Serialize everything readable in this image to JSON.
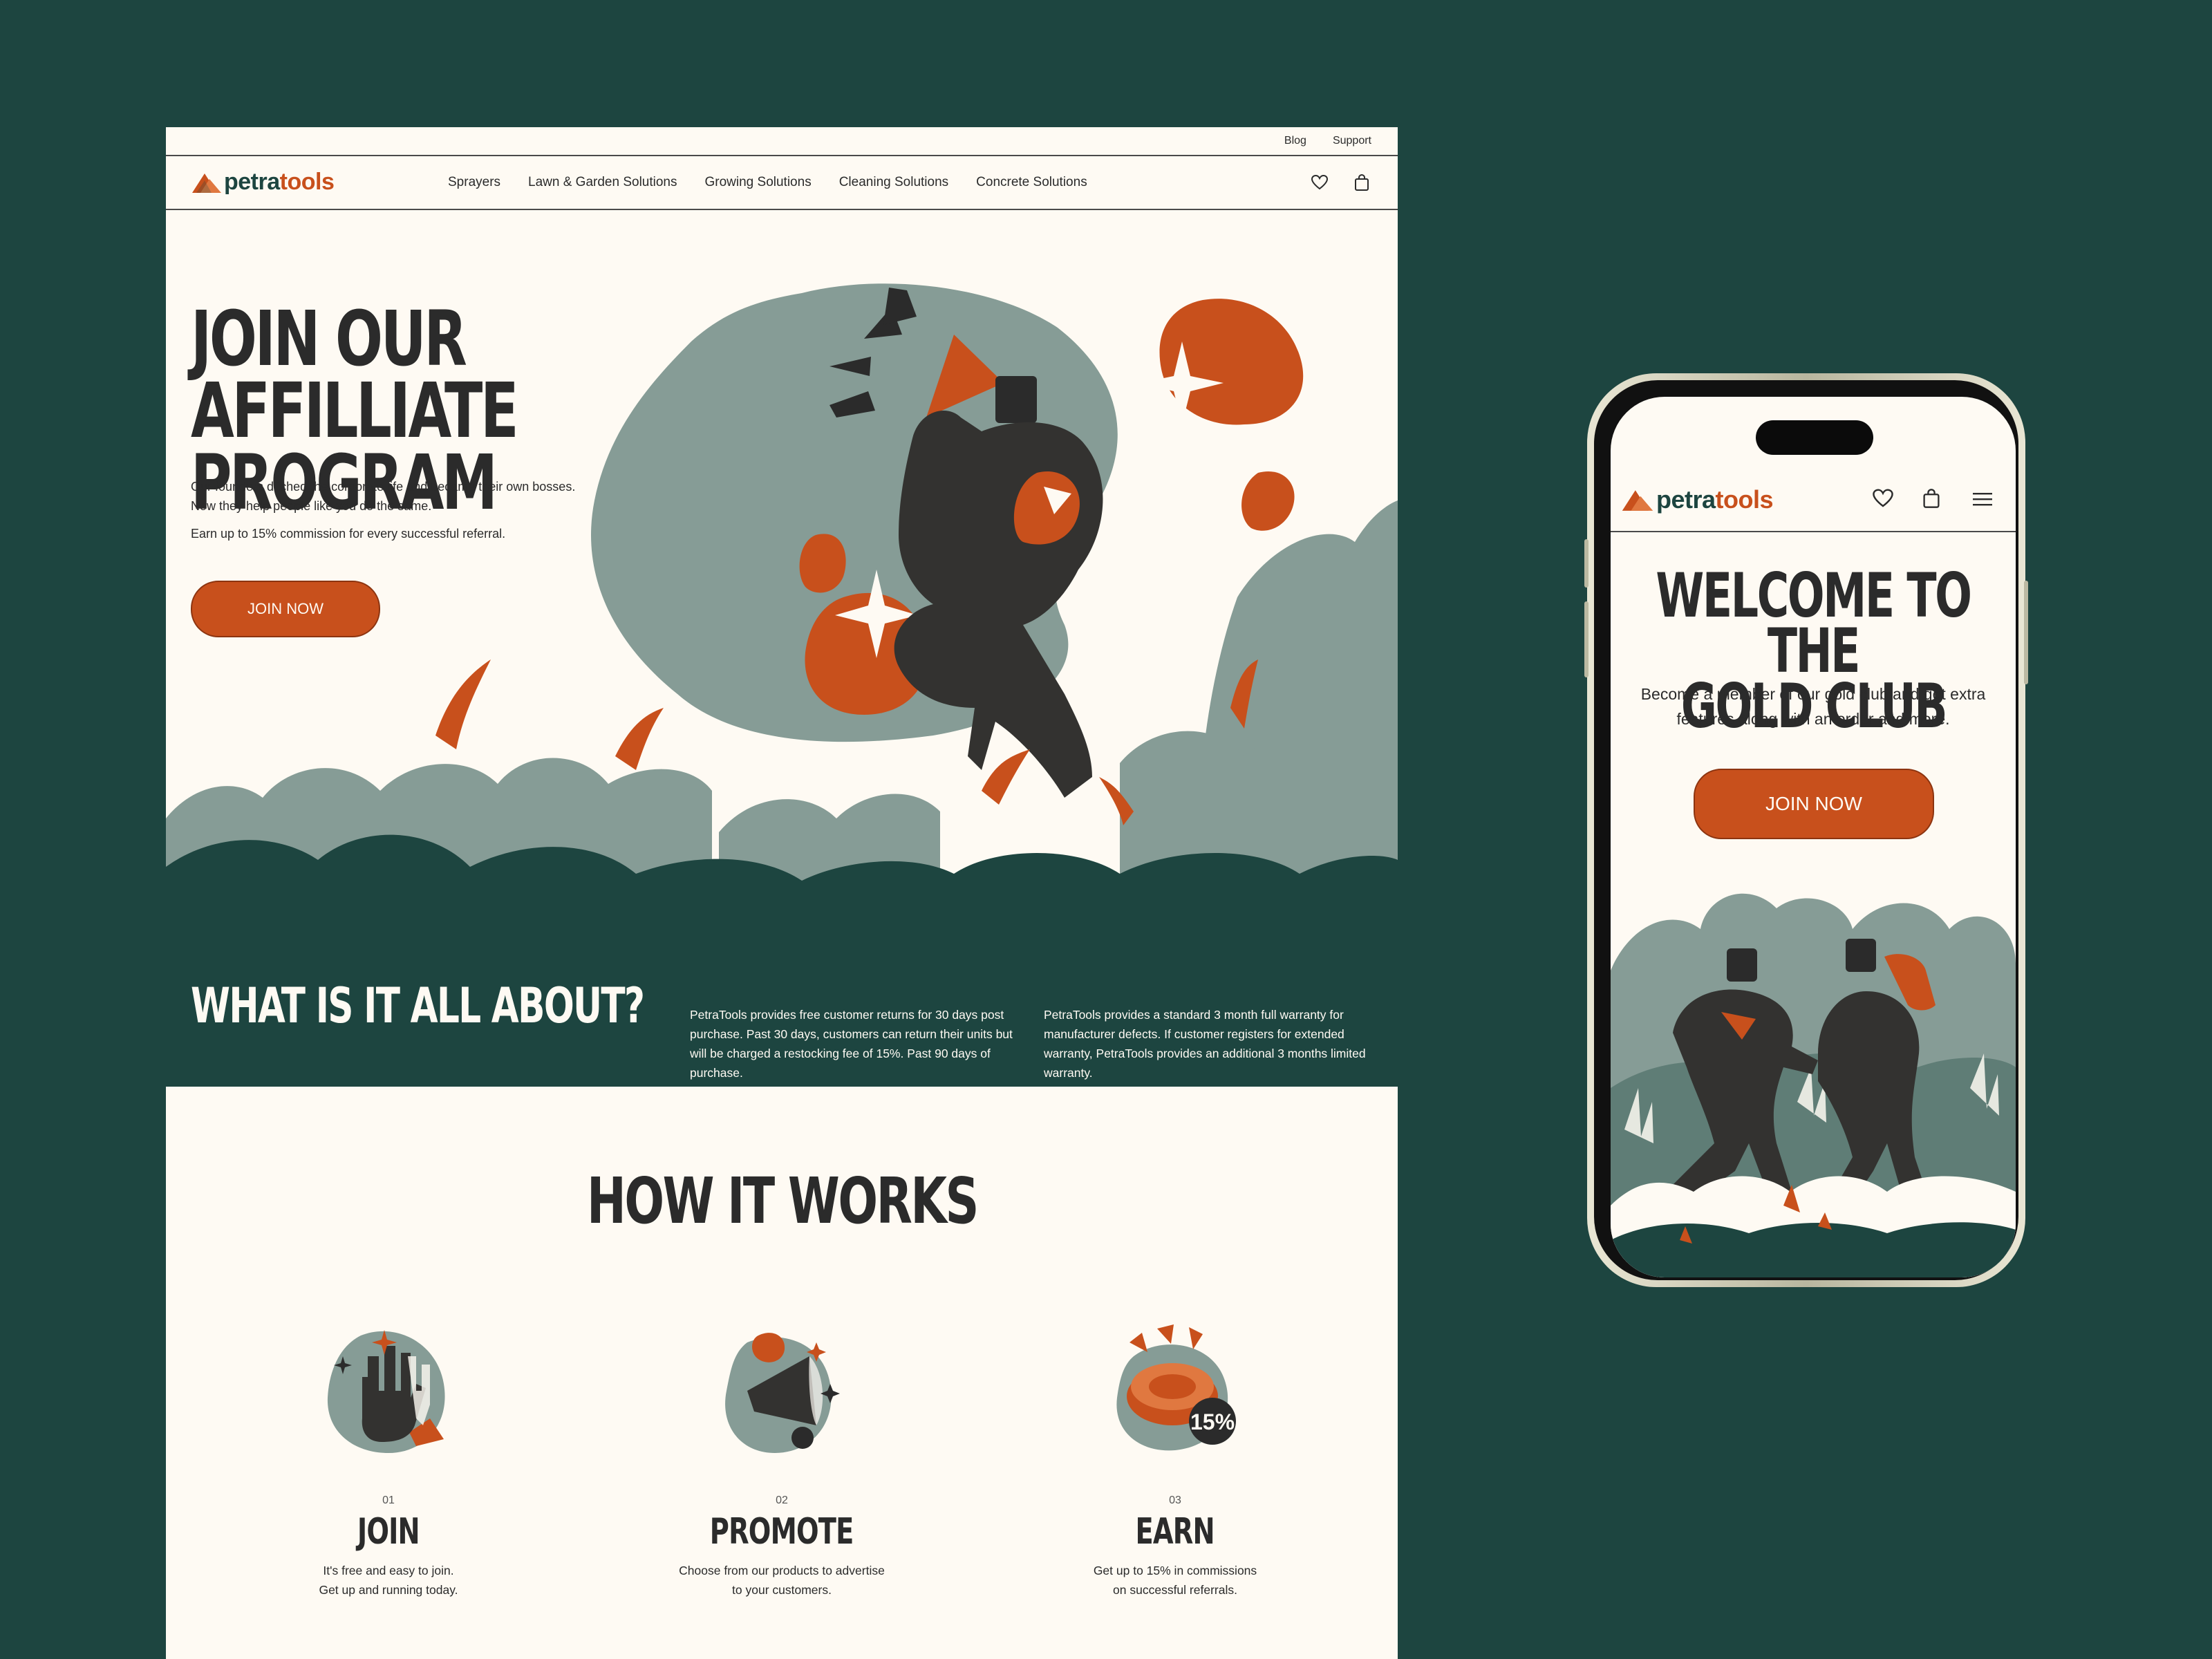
{
  "colors": {
    "background": "#1d4540",
    "page": "#fefaf3",
    "accent": "#c8501c",
    "ink": "#2b2b2b",
    "sage": "#869c96"
  },
  "desktop": {
    "topbar": {
      "links": [
        "Blog",
        "Support"
      ]
    },
    "logo": {
      "part1": "petra",
      "part2": "tools"
    },
    "nav": {
      "items": [
        "Sprayers",
        "Lawn & Garden Solutions",
        "Growing Solutions",
        "Cleaning Solutions",
        "Concrete Solutions"
      ],
      "icons": [
        "heart-icon",
        "shopping-bag-icon"
      ]
    },
    "hero": {
      "title_line1": "JOIN OUR AFFILLIATE",
      "title_line2": "PROGRAM",
      "paragraph1": "Our founders ditched the corporate life and became their own bosses. Now they help people like you do the same.",
      "paragraph2": "Earn up to 15% commission for every successful referral.",
      "button": "JOIN NOW"
    },
    "about": {
      "title": "WHAT IS IT ALL ABOUT?",
      "col1": "PetraTools provides free customer returns for 30 days post purchase. Past 30 days, customers can return their units but will be charged a restocking fee of 15%. Past 90 days of purchase.",
      "col2": "PetraTools provides a standard 3 month full warranty for manufacturer defects. If customer registers for extended warranty, PetraTools provides an additional 3 months limited warranty."
    },
    "how": {
      "title": "HOW IT WORKS",
      "steps": [
        {
          "num": "01",
          "title": "JOIN",
          "line1": "It's free and easy to join.",
          "line2": "Get up and running today."
        },
        {
          "num": "02",
          "title": "PROMOTE",
          "line1": "Choose from our products to advertise",
          "line2": "to your customers."
        },
        {
          "num": "03",
          "title": "EARN",
          "line1": "Get up to 15% in commissions",
          "line2": "on successful referrals.",
          "badge": "15%"
        }
      ]
    }
  },
  "mobile": {
    "logo": {
      "part1": "petra",
      "part2": "tools"
    },
    "icons": [
      "heart-icon",
      "shopping-bag-icon",
      "menu-icon"
    ],
    "title_line1": "WELCOME TO THE",
    "title_line2": "GOLD CLUB",
    "text_line1": "Become a member of our gold club and get extra",
    "text_line2": "features along with an order and more.",
    "button": "JOIN NOW"
  }
}
